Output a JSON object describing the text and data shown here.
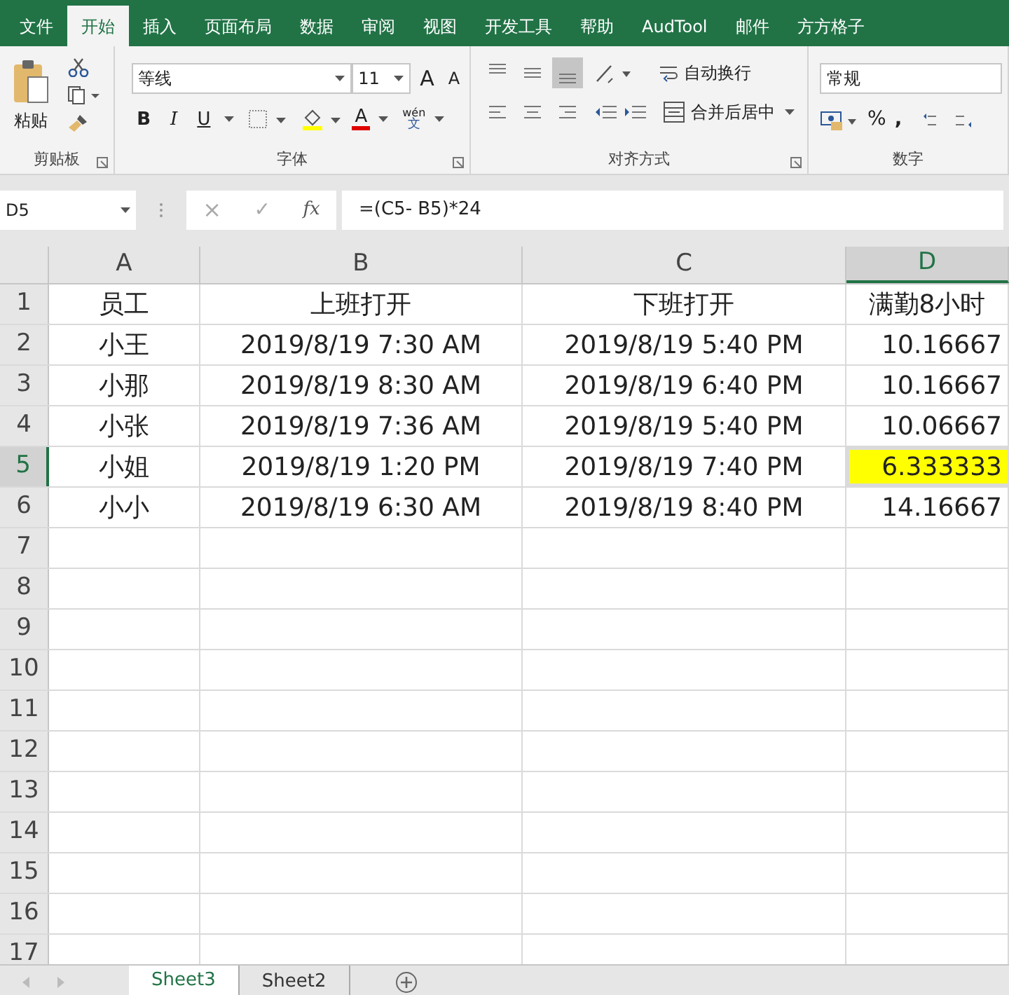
{
  "ribbon_tabs": [
    {
      "label": "文件",
      "selected": false
    },
    {
      "label": "开始",
      "selected": true
    },
    {
      "label": "插入",
      "selected": false
    },
    {
      "label": "页面布局",
      "selected": false
    },
    {
      "label": "数据",
      "selected": false
    },
    {
      "label": "审阅",
      "selected": false
    },
    {
      "label": "视图",
      "selected": false
    },
    {
      "label": "开发工具",
      "selected": false
    },
    {
      "label": "帮助",
      "selected": false
    },
    {
      "label": "AudTool",
      "selected": false
    },
    {
      "label": "邮件",
      "selected": false
    },
    {
      "label": "方方格子",
      "selected": false
    }
  ],
  "ribbon": {
    "clipboard": {
      "paste": "粘贴",
      "group_label": "剪贴板"
    },
    "font": {
      "name": "等线",
      "size": "11",
      "grow": "A",
      "shrink": "A",
      "bold": "B",
      "italic": "I",
      "underline": "U",
      "font_color": "A",
      "phonetic_top": "wén",
      "phonetic_bottom": "文",
      "group_label": "字体"
    },
    "alignment": {
      "vertical_buttons": [
        {
          "selected": false
        },
        {
          "selected": false
        },
        {
          "selected": true
        }
      ],
      "wrap_text": "自动换行",
      "merge_center": "合并后居中",
      "group_label": "对齐方式"
    },
    "number": {
      "format": "常规",
      "percent": "%",
      "comma": ",",
      "group_label": "数字"
    }
  },
  "formula_bar": {
    "name_box": "D5",
    "cancel": "×",
    "enter": "✓",
    "fx": "fx",
    "formula": "=(C5- B5)*24"
  },
  "sheet": {
    "columns": [
      {
        "label": "A",
        "selected": false
      },
      {
        "label": "B",
        "selected": false
      },
      {
        "label": "C",
        "selected": false
      },
      {
        "label": "D",
        "selected": true
      }
    ],
    "rows": [
      {
        "number": "1",
        "selected": false,
        "cells": [
          {
            "value": "员工",
            "selected": false,
            "highlighted": false
          },
          {
            "value": "上班打开",
            "selected": false,
            "highlighted": false
          },
          {
            "value": "下班打开",
            "selected": false,
            "highlighted": false
          },
          {
            "value": "满勤8小时",
            "selected": false,
            "highlighted": false
          }
        ]
      },
      {
        "number": "2",
        "selected": false,
        "cells": [
          {
            "value": "小王",
            "selected": false,
            "highlighted": false
          },
          {
            "value": "2019/8/19 7:30 AM",
            "selected": false,
            "highlighted": false
          },
          {
            "value": "2019/8/19 5:40 PM",
            "selected": false,
            "highlighted": false
          },
          {
            "value": "10.16667",
            "selected": false,
            "highlighted": false
          }
        ]
      },
      {
        "number": "3",
        "selected": false,
        "cells": [
          {
            "value": "小那",
            "selected": false,
            "highlighted": false
          },
          {
            "value": "2019/8/19 8:30 AM",
            "selected": false,
            "highlighted": false
          },
          {
            "value": "2019/8/19 6:40 PM",
            "selected": false,
            "highlighted": false
          },
          {
            "value": "10.16667",
            "selected": false,
            "highlighted": false
          }
        ]
      },
      {
        "number": "4",
        "selected": false,
        "cells": [
          {
            "value": "小张",
            "selected": false,
            "highlighted": false
          },
          {
            "value": "2019/8/19 7:36 AM",
            "selected": false,
            "highlighted": false
          },
          {
            "value": "2019/8/19 5:40 PM",
            "selected": false,
            "highlighted": false
          },
          {
            "value": "10.06667",
            "selected": false,
            "highlighted": false
          }
        ]
      },
      {
        "number": "5",
        "selected": true,
        "cells": [
          {
            "value": "小姐",
            "selected": false,
            "highlighted": false
          },
          {
            "value": "2019/8/19 1:20 PM",
            "selected": false,
            "highlighted": false
          },
          {
            "value": "2019/8/19 7:40 PM",
            "selected": false,
            "highlighted": false
          },
          {
            "value": "6.333333",
            "selected": true,
            "highlighted": true
          }
        ]
      },
      {
        "number": "6",
        "selected": false,
        "cells": [
          {
            "value": "小小",
            "selected": false,
            "highlighted": false
          },
          {
            "value": "2019/8/19 6:30 AM",
            "selected": false,
            "highlighted": false
          },
          {
            "value": "2019/8/19 8:40 PM",
            "selected": false,
            "highlighted": false
          },
          {
            "value": "14.16667",
            "selected": false,
            "highlighted": false
          }
        ]
      },
      {
        "number": "7",
        "selected": false
      },
      {
        "number": "8",
        "selected": false
      },
      {
        "number": "9",
        "selected": false
      },
      {
        "number": "10",
        "selected": false
      },
      {
        "number": "11",
        "selected": false
      },
      {
        "number": "12",
        "selected": false
      },
      {
        "number": "13",
        "selected": false
      },
      {
        "number": "14",
        "selected": false
      },
      {
        "number": "15",
        "selected": false
      },
      {
        "number": "16",
        "selected": false
      },
      {
        "number": "17",
        "selected": false
      }
    ]
  },
  "sheet_tabs": [
    {
      "label": "Sheet3",
      "selected": true
    },
    {
      "label": "Sheet2",
      "selected": false
    }
  ]
}
